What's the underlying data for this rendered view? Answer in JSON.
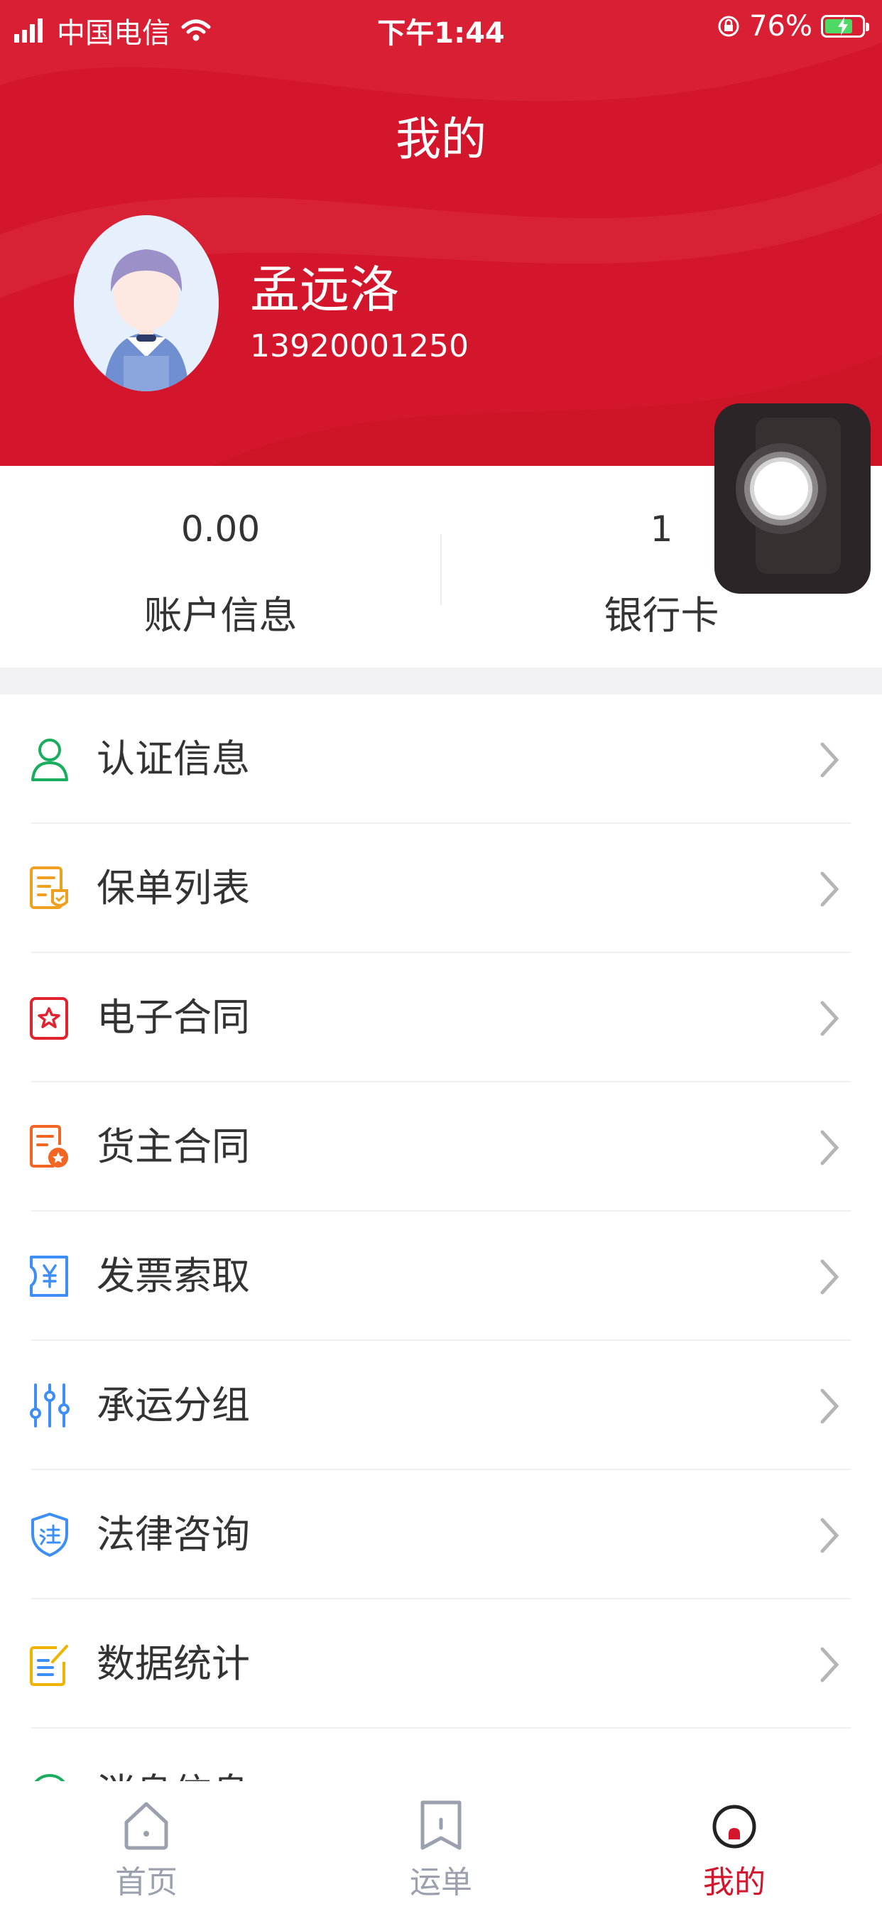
{
  "status_bar": {
    "carrier": "中国电信",
    "time": "下午1:44",
    "battery_percent": "76%",
    "battery_level": 0.76
  },
  "header": {
    "title": "我的",
    "user_name": "孟远洛",
    "phone": "13920001250"
  },
  "stats": [
    {
      "value": "0.00",
      "label": "账户信息"
    },
    {
      "value": "1",
      "label": "银行卡"
    }
  ],
  "menu": [
    {
      "label": "认证信息",
      "icon": "user-icon",
      "color": "#1aad5e"
    },
    {
      "label": "保单列表",
      "icon": "policy-icon",
      "color": "#f0a020"
    },
    {
      "label": "电子合同",
      "icon": "star-contract-icon",
      "color": "#e0232f"
    },
    {
      "label": "货主合同",
      "icon": "seal-contract-icon",
      "color": "#f26522"
    },
    {
      "label": "发票索取",
      "icon": "invoice-icon",
      "color": "#3d8ff5"
    },
    {
      "label": "承运分组",
      "icon": "sliders-icon",
      "color": "#3d8ff5"
    },
    {
      "label": "法律咨询",
      "icon": "law-shield-icon",
      "color": "#3d8ff5"
    },
    {
      "label": "数据统计",
      "icon": "edit-chart-icon",
      "color": "#f0b400"
    },
    {
      "label": "消息信息",
      "icon": "message-icon",
      "color": "#1aad5e"
    }
  ],
  "tabbar": {
    "items": [
      {
        "label": "首页",
        "icon": "home-icon"
      },
      {
        "label": "运单",
        "icon": "bookmark-icon"
      },
      {
        "label": "我的",
        "icon": "profile-icon"
      }
    ],
    "active": 2,
    "active_color": "#d3162b",
    "inactive_color": "#9aa0ad"
  },
  "colors": {
    "brand": "#d3162b"
  }
}
